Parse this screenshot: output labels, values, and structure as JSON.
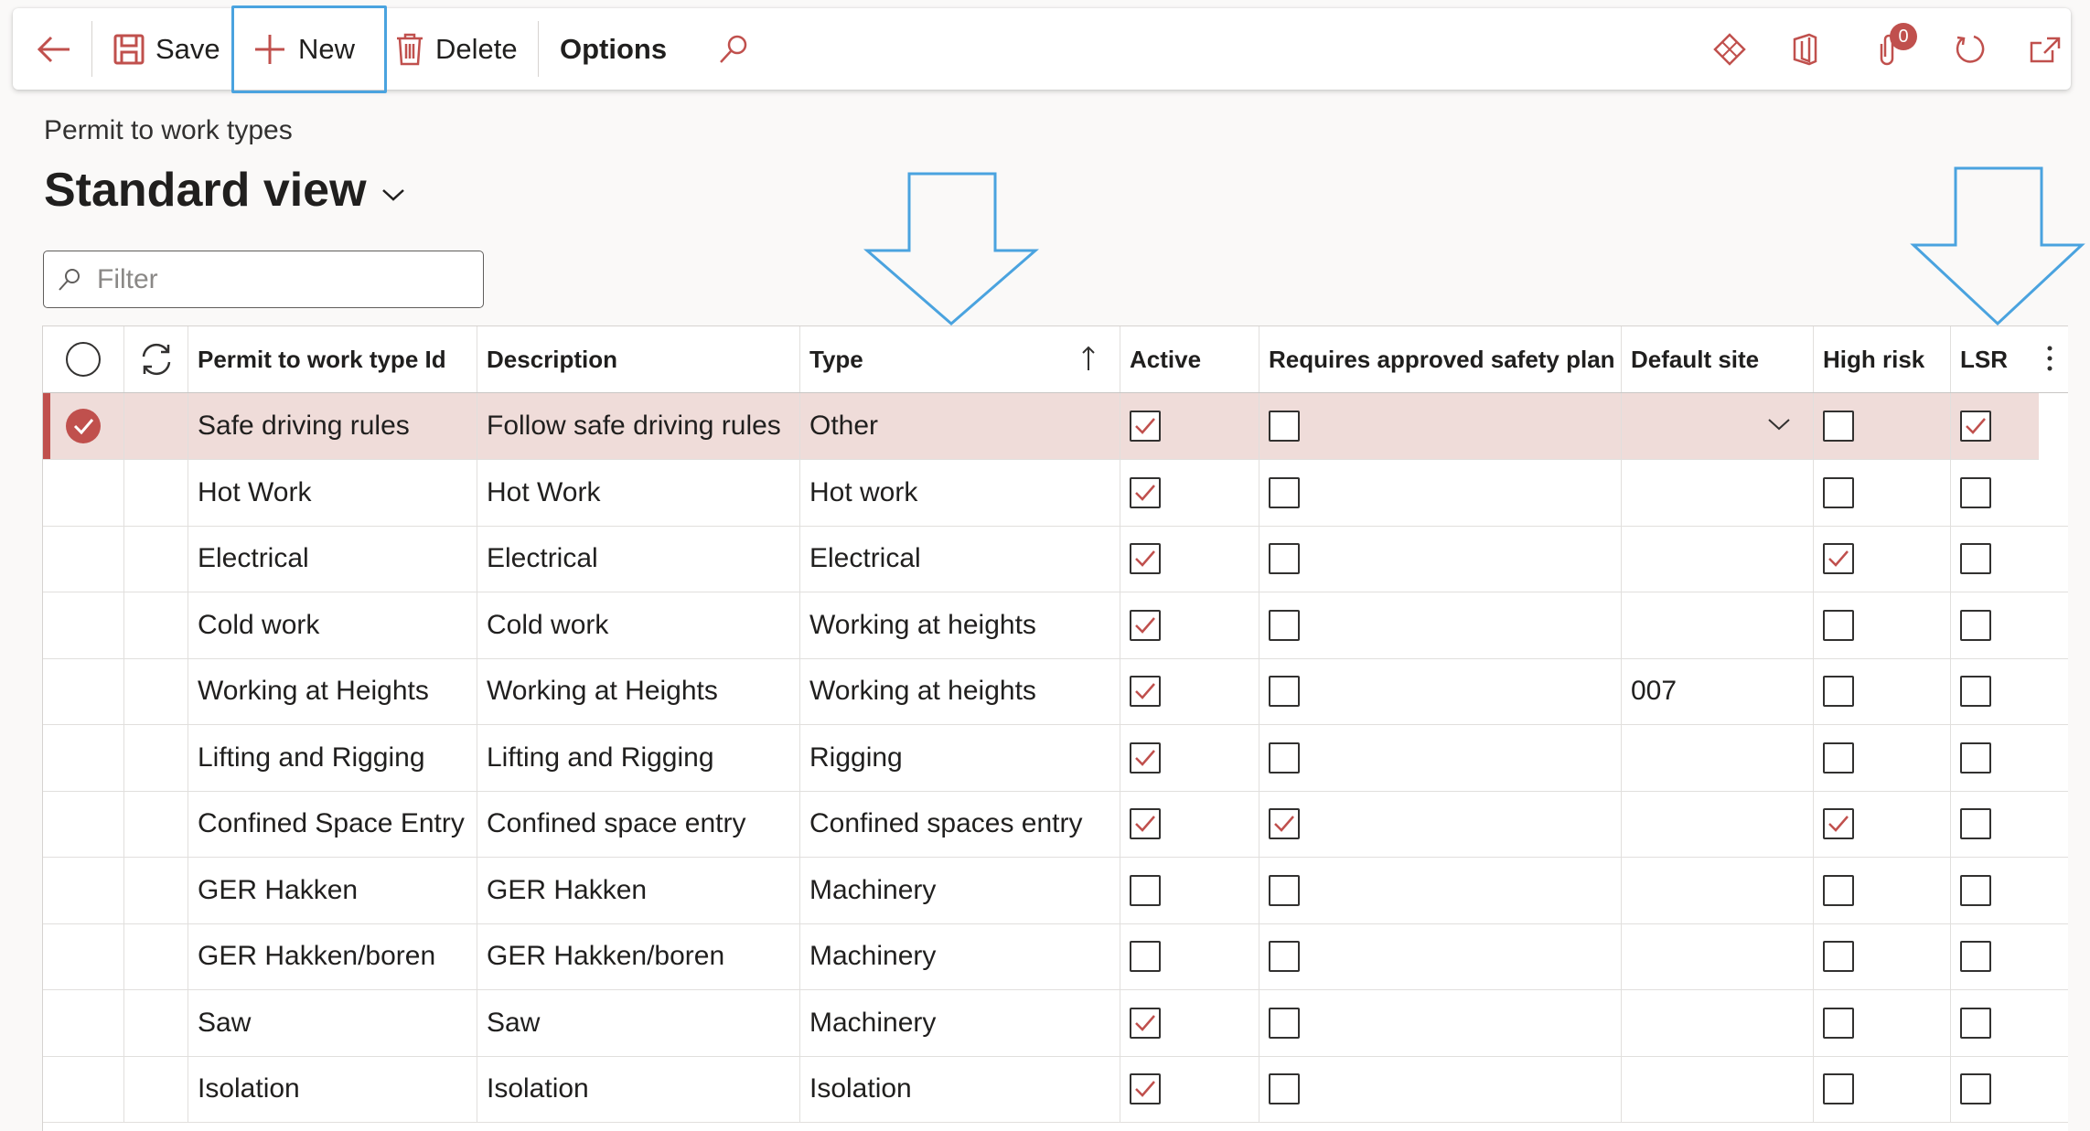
{
  "toolbar": {
    "save_label": "Save",
    "new_label": "New",
    "delete_label": "Delete",
    "options_label": "Options",
    "notification_count": "0"
  },
  "page": {
    "breadcrumb": "Permit to work types",
    "view_title": "Standard view",
    "filter_placeholder": "Filter"
  },
  "colors": {
    "accent": "#c0504d",
    "highlight_outline": "#4aa3df",
    "selected_row": "#efdcd9"
  },
  "columns": [
    "Permit to work type Id",
    "Description",
    "Type",
    "Active",
    "Requires approved safety plan",
    "Default site",
    "High risk",
    "LSR"
  ],
  "rows": [
    {
      "id": "Safe driving rules",
      "description": "Follow safe driving rules",
      "type": "Other",
      "active": true,
      "safety_plan": false,
      "site": "",
      "high_risk": false,
      "lsr": true,
      "selected": true
    },
    {
      "id": "Hot Work",
      "description": "Hot Work",
      "type": "Hot work",
      "active": true,
      "safety_plan": false,
      "site": "",
      "high_risk": false,
      "lsr": false,
      "selected": false
    },
    {
      "id": "Electrical",
      "description": "Electrical",
      "type": "Electrical",
      "active": true,
      "safety_plan": false,
      "site": "",
      "high_risk": true,
      "lsr": false,
      "selected": false
    },
    {
      "id": "Cold work",
      "description": "Cold work",
      "type": "Working at heights",
      "active": true,
      "safety_plan": false,
      "site": "",
      "high_risk": false,
      "lsr": false,
      "selected": false
    },
    {
      "id": "Working at Heights",
      "description": "Working at Heights",
      "type": "Working at heights",
      "active": true,
      "safety_plan": false,
      "site": "007",
      "high_risk": false,
      "lsr": false,
      "selected": false
    },
    {
      "id": "Lifting and Rigging",
      "description": "Lifting and Rigging",
      "type": "Rigging",
      "active": true,
      "safety_plan": false,
      "site": "",
      "high_risk": false,
      "lsr": false,
      "selected": false
    },
    {
      "id": "Confined Space Entry",
      "description": "Confined space entry",
      "type": "Confined spaces entry",
      "active": true,
      "safety_plan": true,
      "site": "",
      "high_risk": true,
      "lsr": false,
      "selected": false
    },
    {
      "id": "GER Hakken",
      "description": "GER Hakken",
      "type": "Machinery",
      "active": false,
      "safety_plan": false,
      "site": "",
      "high_risk": false,
      "lsr": false,
      "selected": false
    },
    {
      "id": "GER Hakken/boren",
      "description": "GER Hakken/boren",
      "type": "Machinery",
      "active": false,
      "safety_plan": false,
      "site": "",
      "high_risk": false,
      "lsr": false,
      "selected": false
    },
    {
      "id": "Saw",
      "description": "Saw",
      "type": "Machinery",
      "active": true,
      "safety_plan": false,
      "site": "",
      "high_risk": false,
      "lsr": false,
      "selected": false
    },
    {
      "id": "Isolation",
      "description": "Isolation",
      "type": "Isolation",
      "active": true,
      "safety_plan": false,
      "site": "",
      "high_risk": false,
      "lsr": false,
      "selected": false
    }
  ]
}
